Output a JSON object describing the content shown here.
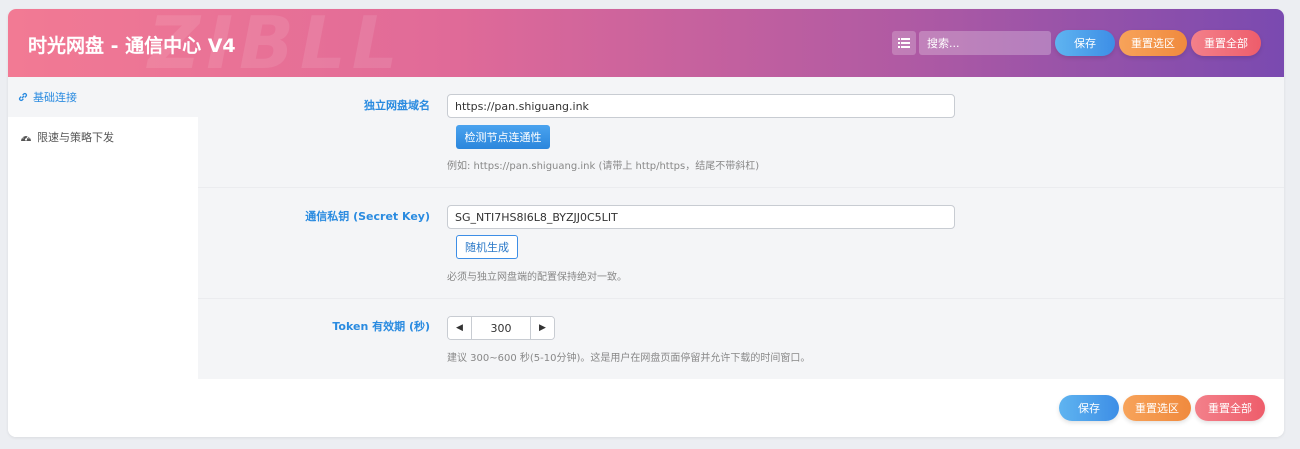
{
  "header": {
    "title": "时光网盘 - 通信中心 V4",
    "watermark": "ZIBLL",
    "search_placeholder": "搜索...",
    "save_label": "保存",
    "reset_section_label": "重置选区",
    "reset_all_label": "重置全部"
  },
  "sidebar": {
    "items": [
      {
        "label": "基础连接",
        "icon": "link-icon",
        "active": true
      },
      {
        "label": "限速与策略下发",
        "icon": "dashboard-icon",
        "active": false
      }
    ]
  },
  "form": {
    "domain": {
      "label": "独立网盘域名",
      "value": "https://pan.shiguang.ink",
      "button": "检测节点连通性",
      "hint": "例如: https://pan.shiguang.ink (请带上 http/https，结尾不带斜杠)"
    },
    "secret": {
      "label": "通信私钥 (Secret Key)",
      "value": "SG_NTI7HS8I6L8_BYZJJ0C5LIT",
      "button": "随机生成",
      "hint": "必须与独立网盘端的配置保持绝对一致。"
    },
    "token": {
      "label": "Token 有效期 (秒)",
      "value": "300",
      "hint": "建议 300~600 秒(5-10分钟)。这是用户在网盘页面停留并允许下载的时间窗口。"
    }
  },
  "footer": {
    "save_label": "保存",
    "reset_section_label": "重置选区",
    "reset_all_label": "重置全部"
  },
  "colors": {
    "accent_blue": "#2a8be0",
    "header_gradient_start": "#f27a94",
    "header_gradient_end": "#7a4ab0",
    "orange": "#f08a3e",
    "red": "#ee5d6b"
  }
}
